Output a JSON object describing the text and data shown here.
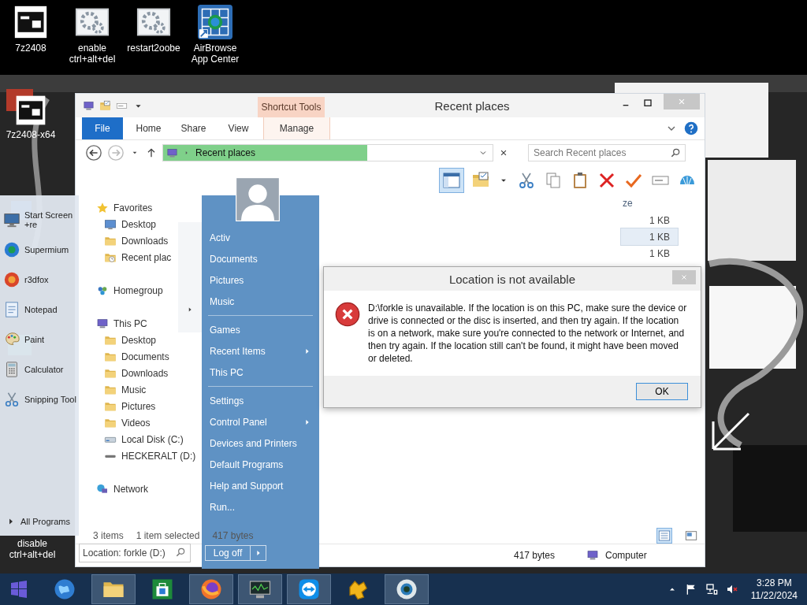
{
  "desktop": {
    "icons": [
      {
        "label": "7z2408",
        "kind": "archive"
      },
      {
        "label": "enable ctrl+alt+del",
        "kind": "gears"
      },
      {
        "label": "restart2oobe",
        "kind": "gears"
      },
      {
        "label": "AirBrowse App Center",
        "kind": "appgrid"
      }
    ],
    "side_icons": [
      {
        "label": "7z2408-x64",
        "kind": "archive"
      },
      {
        "label": "disable ctrl+alt+del"
      }
    ]
  },
  "explorer": {
    "title": "Recent places",
    "context_tab": "Shortcut Tools",
    "tabs": [
      {
        "label": "File",
        "kind": "file",
        "selected": false
      },
      {
        "label": "Home",
        "kind": "tab",
        "selected": false
      },
      {
        "label": "Share",
        "kind": "tab",
        "selected": false
      },
      {
        "label": "View",
        "kind": "tab",
        "selected": false
      },
      {
        "label": "Manage",
        "kind": "context",
        "selected": false
      }
    ],
    "address": {
      "path": "Recent places",
      "level": 0.62
    },
    "search": {
      "placeholder": "Search Recent places"
    },
    "toolbar": [
      {
        "kind": "pane",
        "selected": true
      },
      {
        "kind": "properties",
        "selected": false
      },
      {
        "kind": "caret",
        "selected": false
      },
      {
        "kind": "cut",
        "selected": false
      },
      {
        "kind": "copy",
        "selected": false
      },
      {
        "kind": "paste",
        "selected": false
      },
      {
        "kind": "delete",
        "selected": false
      },
      {
        "kind": "check",
        "selected": false
      },
      {
        "kind": "rename",
        "selected": false
      },
      {
        "kind": "shell",
        "selected": false
      }
    ],
    "nav": [
      {
        "label": "Favorites",
        "kind": "star",
        "children": [
          {
            "label": "Desktop",
            "kind": "desktop"
          },
          {
            "label": "Downloads",
            "kind": "folder"
          },
          {
            "label": "Recent plac",
            "kind": "recent"
          }
        ]
      },
      {
        "label": "Homegroup",
        "kind": "homegroup"
      },
      {
        "label": "This PC",
        "kind": "computer",
        "children": [
          {
            "label": "Desktop",
            "kind": "folder"
          },
          {
            "label": "Documents",
            "kind": "folder"
          },
          {
            "label": "Downloads",
            "kind": "folder"
          },
          {
            "label": "Music",
            "kind": "folder"
          },
          {
            "label": "Pictures",
            "kind": "folder"
          },
          {
            "label": "Videos",
            "kind": "folder"
          },
          {
            "label": "Local Disk (C:)",
            "kind": "drive"
          },
          {
            "label": "HECKERALT (D:)",
            "kind": "usb"
          }
        ]
      },
      {
        "label": "Network",
        "kind": "network"
      }
    ],
    "column_header": "ze",
    "rows": [
      {
        "size": "1 KB",
        "selected": false
      },
      {
        "size": "1 KB",
        "selected": true
      },
      {
        "size": "1 KB",
        "selected": false
      }
    ],
    "status": [
      "3 items",
      "1 item selected",
      "417 bytes"
    ],
    "views": [
      {
        "kind": "details",
        "selected": true
      },
      {
        "kind": "tiles",
        "selected": false
      }
    ],
    "bottom": {
      "size": "417 bytes",
      "location": "Computer"
    }
  },
  "start_menu": {
    "pinned": [
      {
        "label": "Start Screen +re",
        "kind": "monitor"
      },
      {
        "label": "Supermium",
        "kind": "browser"
      },
      {
        "label": "r3dfox",
        "kind": "fox"
      },
      {
        "label": "Notepad",
        "kind": "notepad"
      },
      {
        "label": "Paint",
        "kind": "palette"
      },
      {
        "label": "Calculator",
        "kind": "calculator"
      },
      {
        "label": "Snipping Tool",
        "kind": "cut"
      }
    ],
    "all_programs": "All Programs",
    "search": {
      "value": "Location: forkle (D:)"
    },
    "groups": [
      [
        {
          "label": "Activ",
          "submenu": false
        },
        {
          "label": "Documents",
          "submenu": false
        },
        {
          "label": "Pictures",
          "submenu": false
        },
        {
          "label": "Music",
          "submenu": false
        }
      ],
      [
        {
          "label": "Games",
          "submenu": false
        },
        {
          "label": "Recent Items",
          "submenu": true
        },
        {
          "label": "This PC",
          "submenu": false
        }
      ],
      [
        {
          "label": "Settings",
          "submenu": false
        },
        {
          "label": "Control Panel",
          "submenu": true
        },
        {
          "label": "Devices and Printers",
          "submenu": false
        },
        {
          "label": "Default Programs",
          "submenu": false
        },
        {
          "label": "Help and Support",
          "submenu": false
        },
        {
          "label": "Run...",
          "submenu": false
        }
      ]
    ],
    "log_off": "Log off"
  },
  "dialog": {
    "title": "Location is not available",
    "message": "D:\\forkle is unavailable. If the location is on this PC, make sure the device or drive is connected or the disc is inserted, and then try again. If the location is on a network, make sure you're connected to the network or Internet, and then try again. If the location still can't be found, it might have been moved or deleted.",
    "button": "OK"
  },
  "taskbar": {
    "items": [
      {
        "kind": "globe",
        "running": false
      },
      {
        "kind": "folder",
        "running": true
      },
      {
        "kind": "store",
        "running": false
      },
      {
        "kind": "firefox",
        "running": true
      },
      {
        "kind": "monitorapp",
        "running": true
      },
      {
        "kind": "teamviewer",
        "running": true
      },
      {
        "kind": "gamepad",
        "running": false
      },
      {
        "kind": "eye",
        "running": true
      }
    ],
    "muted": true,
    "time": "3:28 PM",
    "date": "11/22/2024"
  }
}
